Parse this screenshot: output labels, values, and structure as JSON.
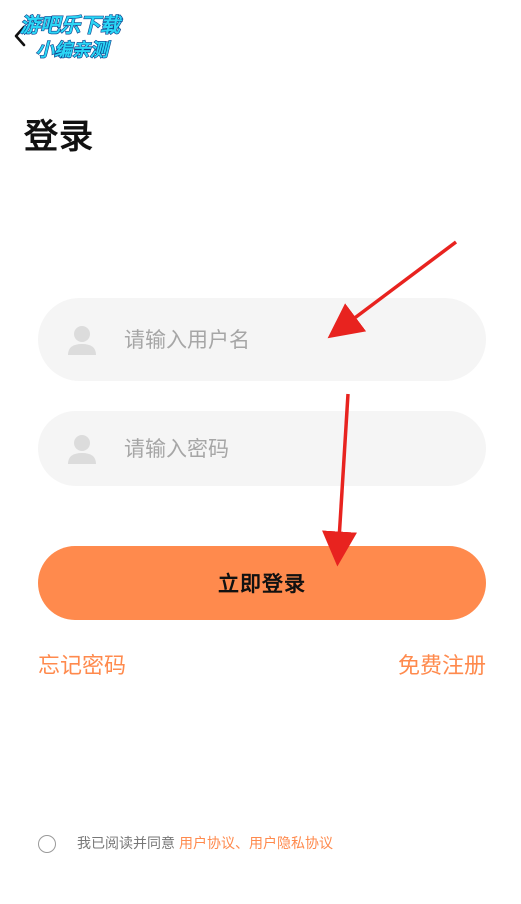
{
  "header": {
    "back_icon": "chevron-left-icon",
    "title": "登录"
  },
  "watermark": {
    "line1": "游吧乐下载",
    "line2": "小编亲测"
  },
  "form": {
    "username": {
      "placeholder": "请输入用户名",
      "value": "",
      "icon": "user-icon"
    },
    "password": {
      "placeholder": "请输入密码",
      "value": "",
      "icon": "user-icon"
    },
    "login_label": "立即登录"
  },
  "links": {
    "forgot": "忘记密码",
    "register": "免费注册"
  },
  "agreement": {
    "checked": false,
    "prefix": "我已阅读并同意",
    "user_agreement": "用户协议",
    "separator": "、",
    "privacy": "用户隐私协议"
  },
  "colors": {
    "accent": "#ff8a4d",
    "field_bg": "#f5f5f5",
    "annotation": "#e8231f"
  }
}
